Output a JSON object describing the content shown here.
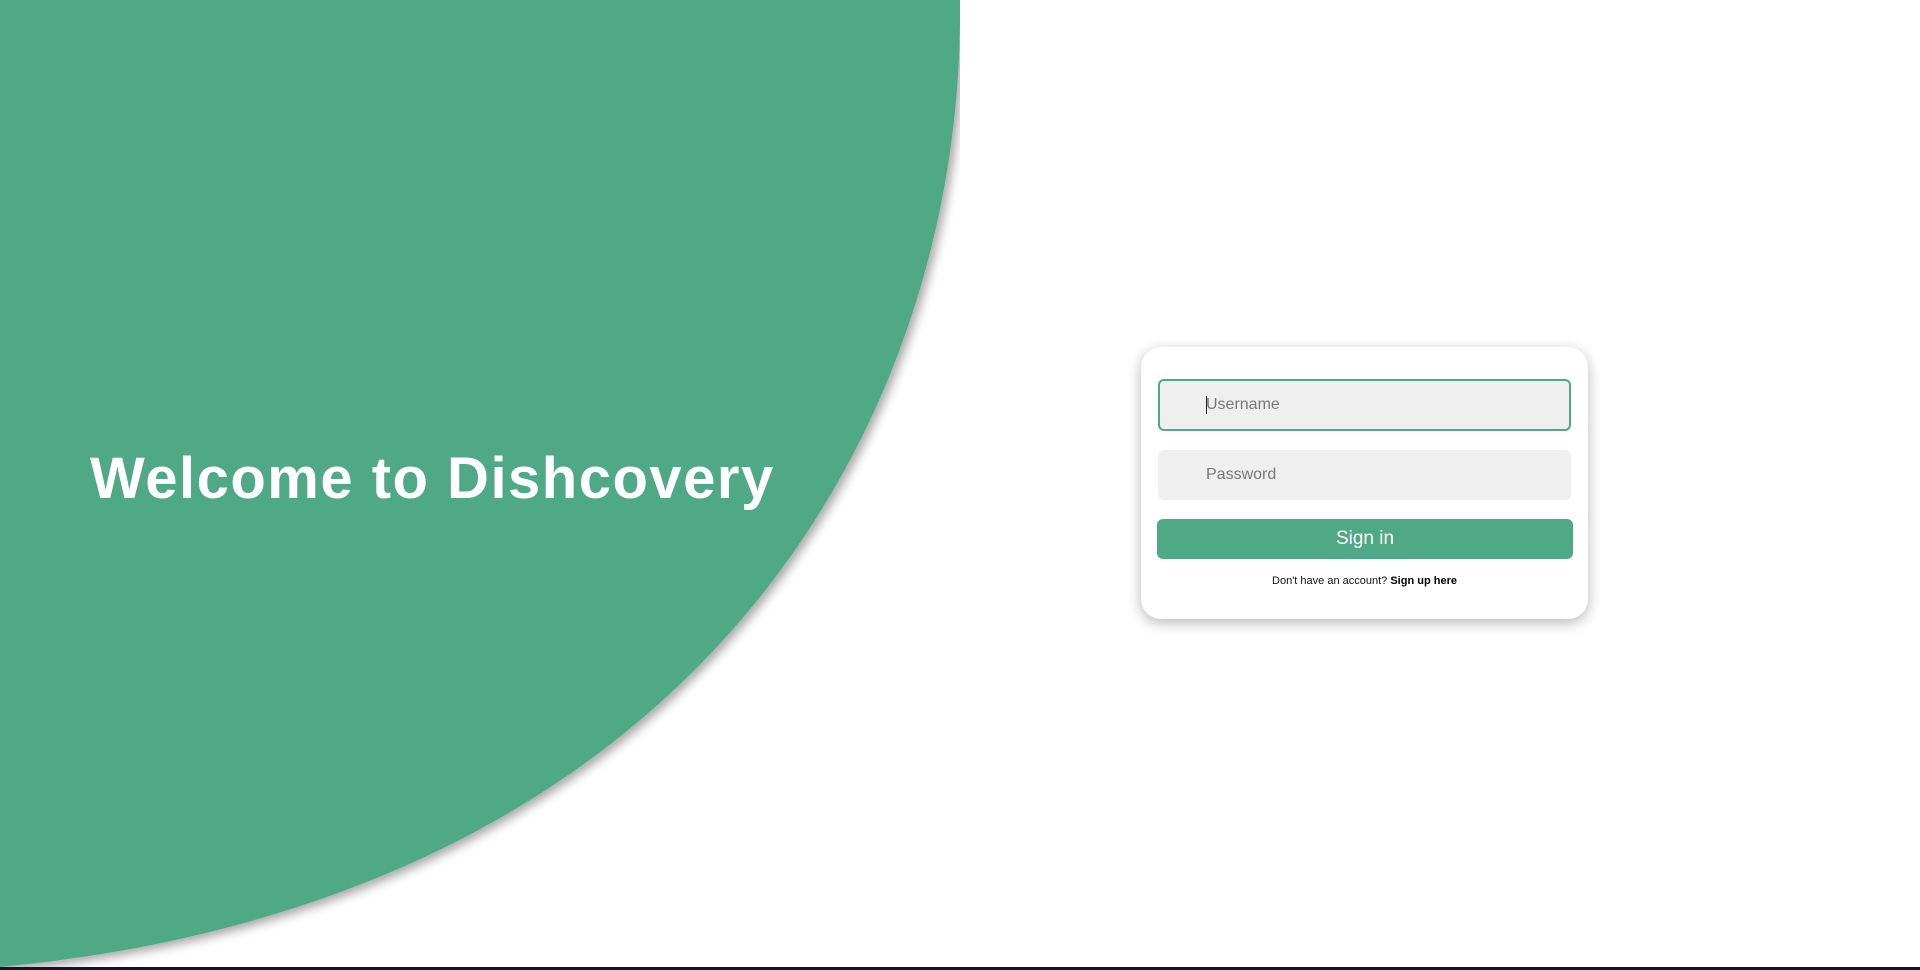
{
  "hero": {
    "title": "Welcome to Dishcovery"
  },
  "login": {
    "username_placeholder": "Username",
    "password_placeholder": "Password",
    "signin_label": "Sign in",
    "signup_prompt": "Don't have an account?",
    "signup_link": "Sign up here"
  },
  "colors": {
    "accent": "#4fa886",
    "input_background": "#efefef",
    "page_background": "#ffffff",
    "title_text": "#ffffff"
  }
}
